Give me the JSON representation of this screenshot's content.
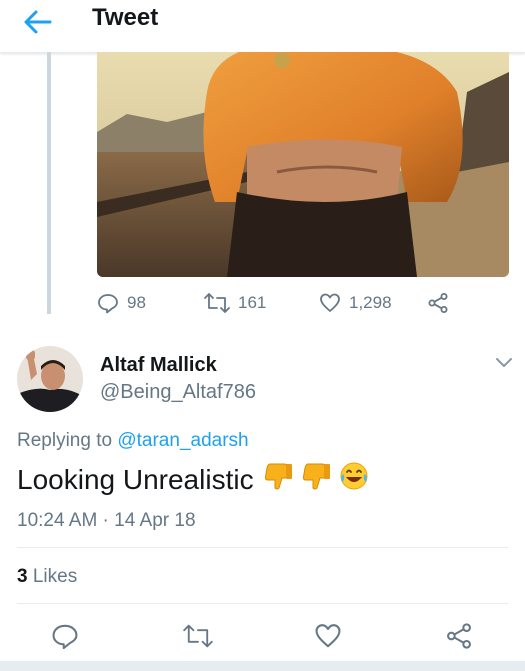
{
  "header": {
    "title": "Tweet",
    "back_icon": "arrow-left-icon",
    "accent": "#1da1f2"
  },
  "parent_tweet": {
    "media_icon": "photo-image",
    "actions": {
      "replies": "98",
      "retweets": "161",
      "likes": "1,298"
    }
  },
  "reply": {
    "author_name": "Altaf Mallick",
    "author_handle": "@Being_Altaf786",
    "replying_prefix": "Replying to",
    "replying_handle": "@taran_adarsh",
    "text": "Looking Unrealistic",
    "emojis": [
      "thumbs-down-icon",
      "thumbs-down-icon",
      "tears-of-joy-icon"
    ],
    "timestamp": "10:24 AM · 14 Apr 18",
    "likes_count": "3",
    "likes_label": "Likes"
  },
  "colors": {
    "text": "#14171a",
    "muted": "#657786",
    "link": "#1da1f2",
    "border": "#e6ecf0"
  }
}
